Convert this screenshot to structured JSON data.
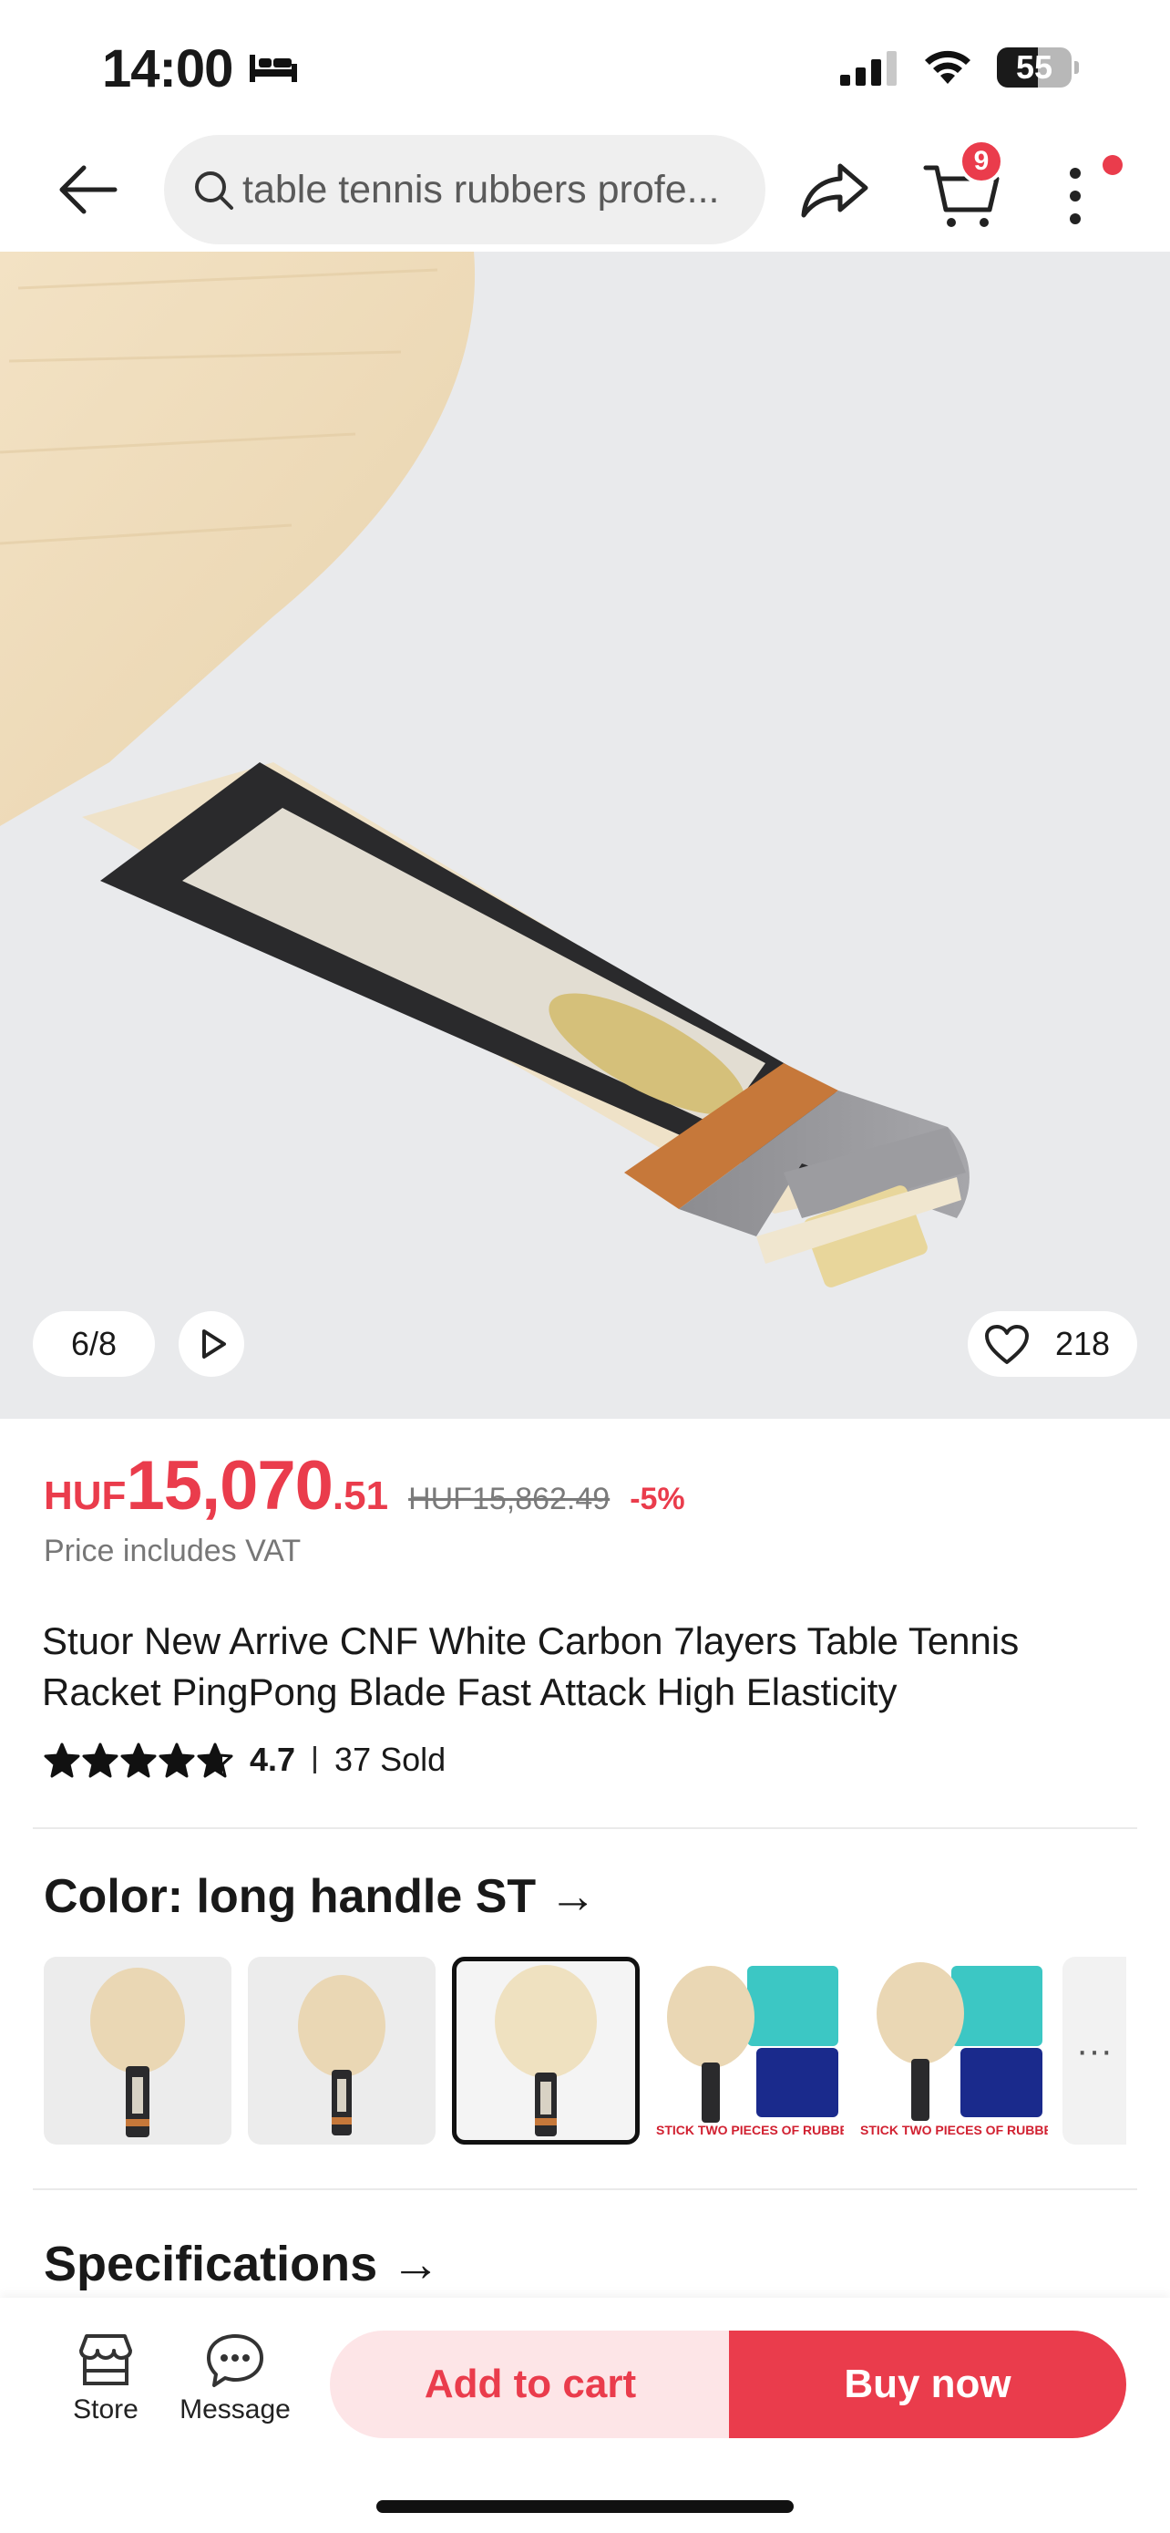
{
  "status_bar": {
    "time": "14:00",
    "battery": "55",
    "battery_level": 0.55
  },
  "header": {
    "search_text": "table tennis rubbers profe...",
    "cart_count": "9"
  },
  "gallery": {
    "counter": "6/8",
    "likes": "218"
  },
  "price": {
    "currency": "HUF",
    "integer": "15,070",
    "decimal": ".51",
    "original": "HUF15,862.49",
    "discount": "-5%",
    "vat_note": "Price includes VAT"
  },
  "product": {
    "title": "Stuor New Arrive CNF White Carbon 7layers  Table Tennis Racket PingPong Blade Fast Attack High Elasticity",
    "rating": "4.7",
    "rating_value": 4.7,
    "sold": "37 Sold"
  },
  "color": {
    "label": "Color: long handle ST →",
    "selected_index": 2,
    "variant_banner": "STICK TWO PIECES OF RUBBERS",
    "more": "···"
  },
  "specs": {
    "label": "Specifications →"
  },
  "bottom": {
    "store": "Store",
    "message": "Message",
    "add_to_cart": "Add to cart",
    "buy_now": "Buy now"
  },
  "colors": {
    "accent": "#ea3c4c",
    "accent_soft": "#fde5e7"
  }
}
